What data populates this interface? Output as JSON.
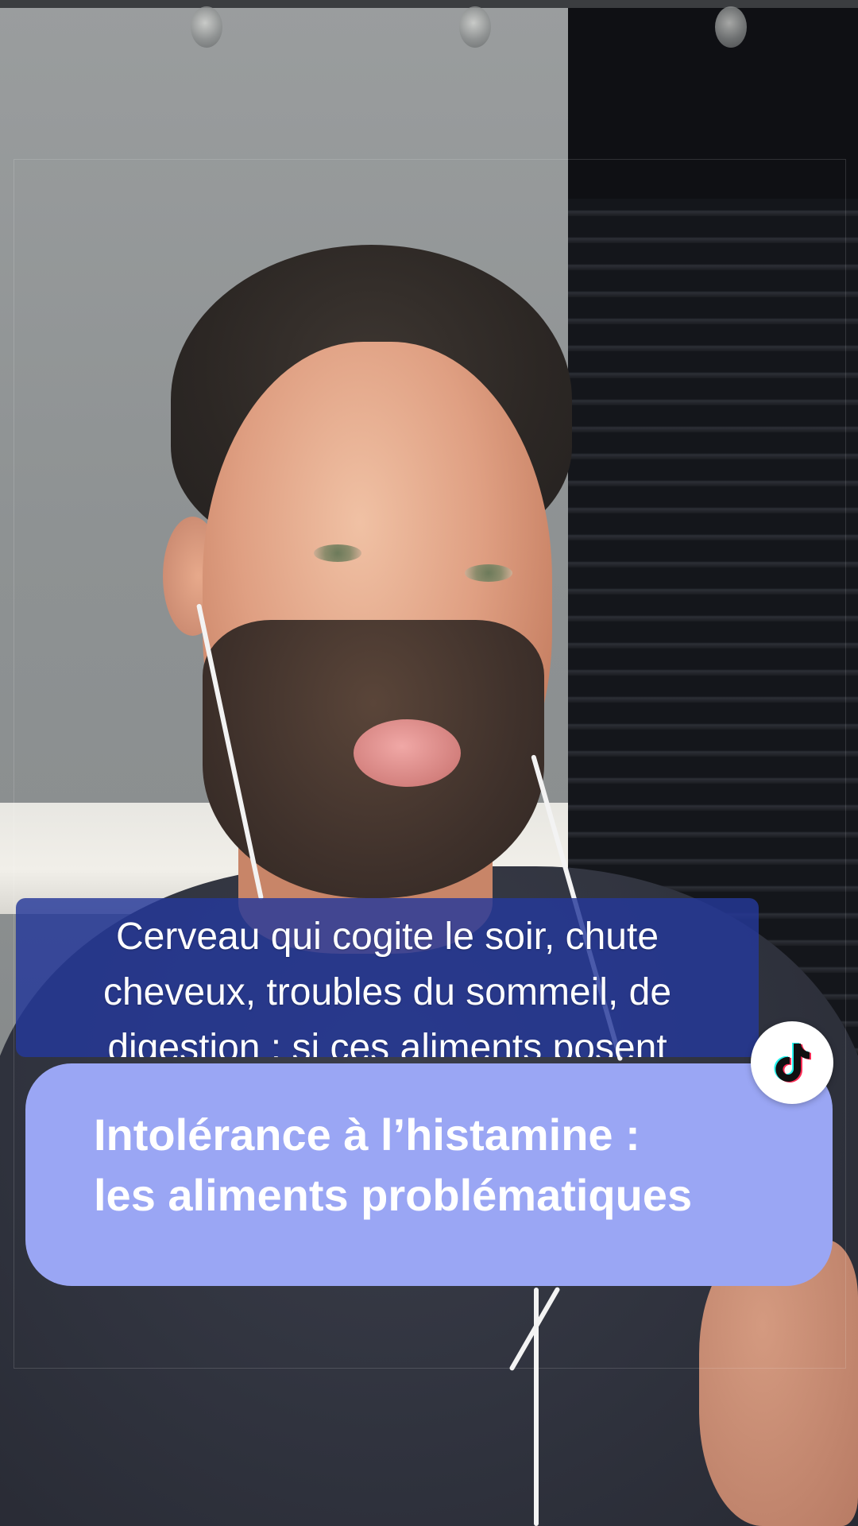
{
  "video": {
    "caption_lines": [
      "Cerveau qui cogite le soir, chute",
      "cheveux, troubles du sommeil, de",
      "digestion : si ces aliments posent"
    ]
  },
  "title_card": {
    "lines": [
      "Intolérance à l’histamine :",
      "les aliments problématiques"
    ],
    "background": "#9aa6f4",
    "text_color": "#ffffff"
  },
  "caption_style": {
    "background": "#24389a"
  },
  "tiktok_button": {
    "icon": "tiktok-logo-icon"
  }
}
